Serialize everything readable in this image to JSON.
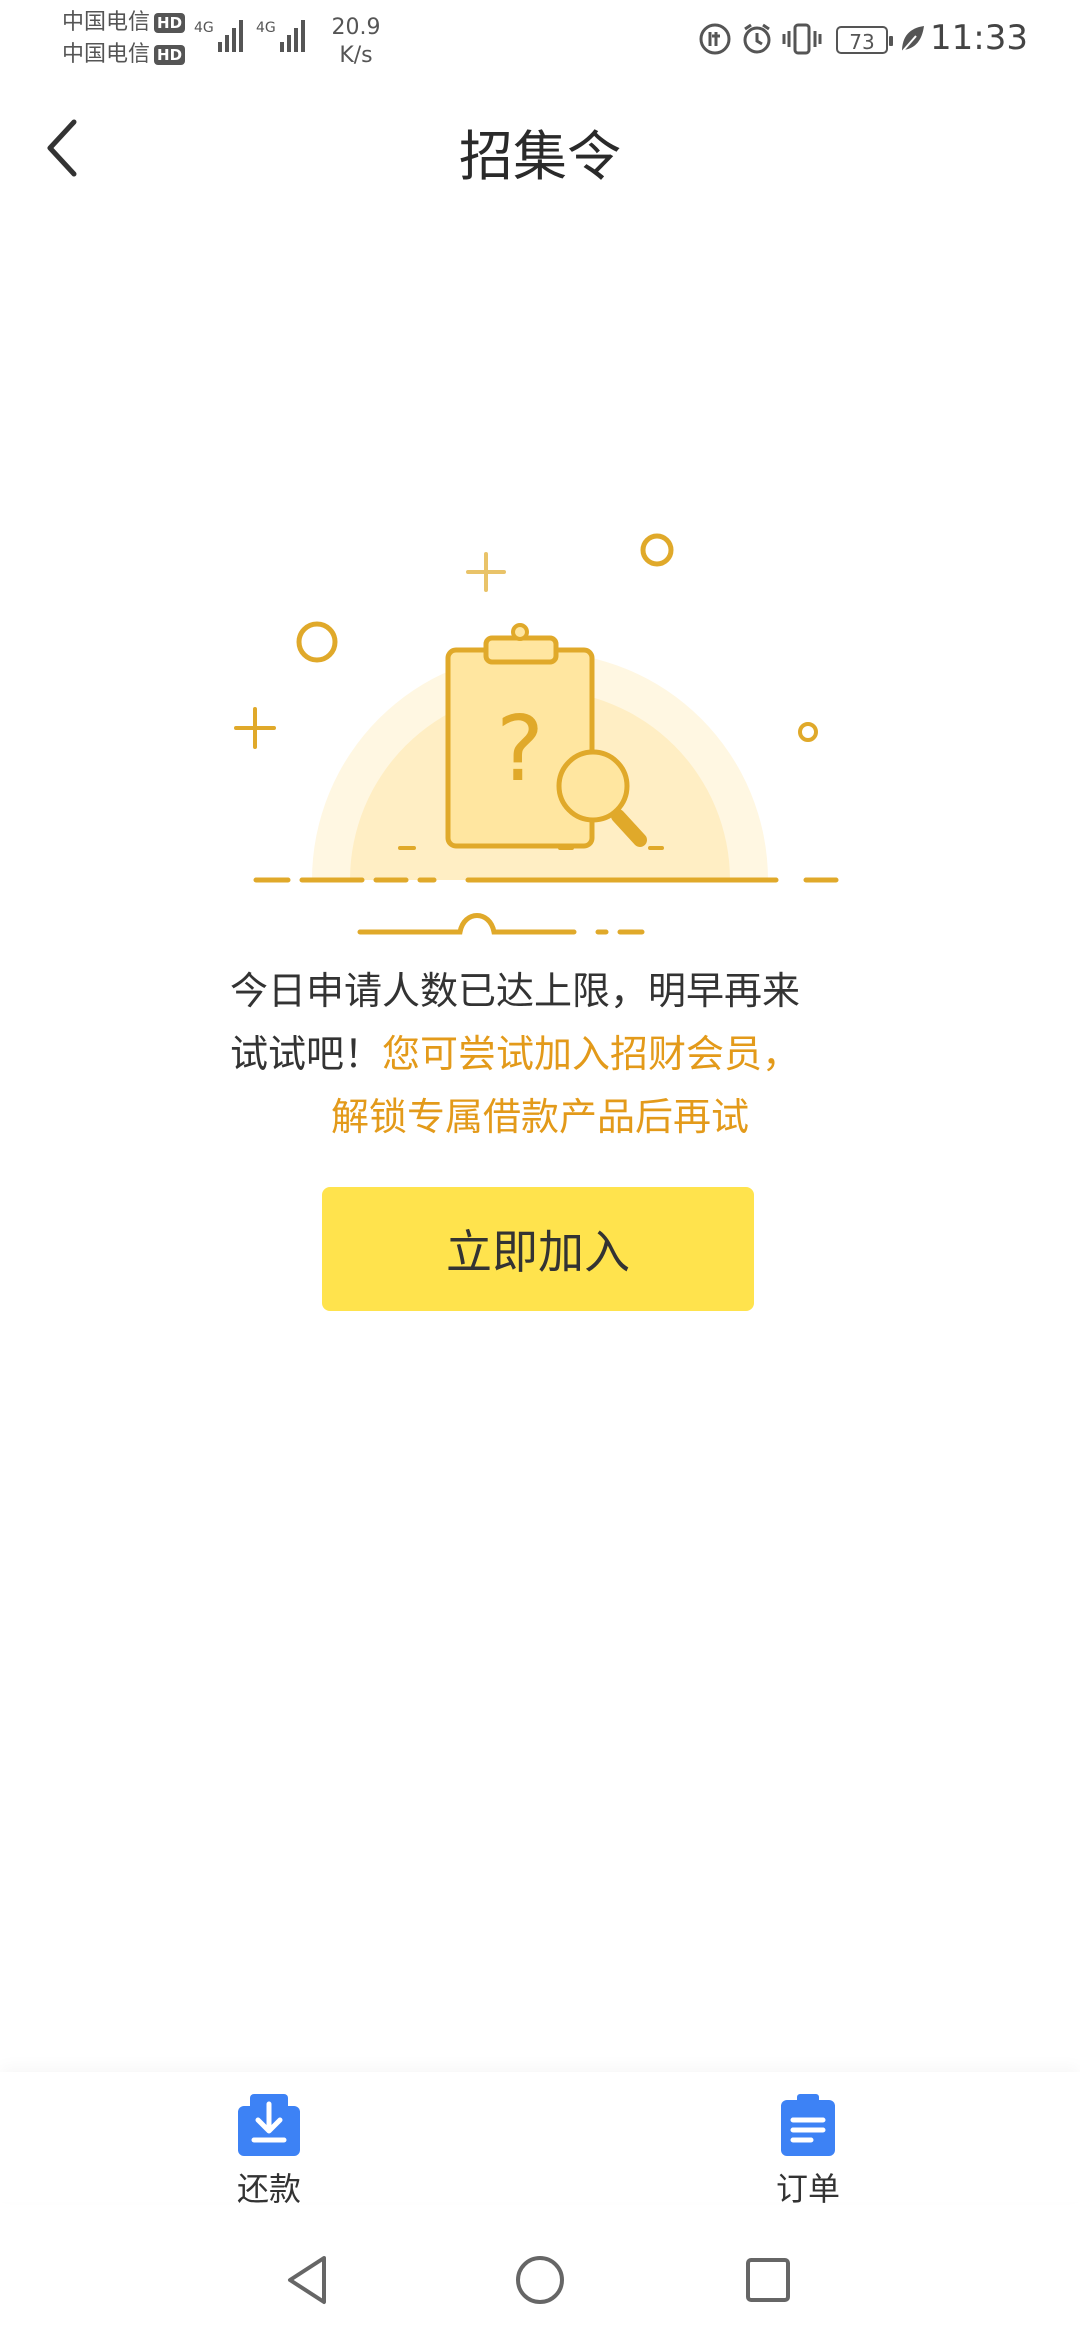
{
  "status_bar": {
    "carrier1": "中国电信",
    "carrier2": "中国电信",
    "hd_badge": "HD",
    "network1": "4G",
    "network2": "4G",
    "speed_value": "20.9",
    "speed_unit": "K/s",
    "battery": "73",
    "time": "11:33"
  },
  "header": {
    "title": "招集令"
  },
  "message": {
    "line1": "今日申请人数已达上限，明早再来",
    "line2_black": "试试吧！",
    "line2_orange": "您可尝试加入招财会员，",
    "line3_orange": "解锁专属借款产品后再试"
  },
  "join_button": {
    "label": "立即加入"
  },
  "bottom_nav": {
    "items": [
      {
        "label": "还款",
        "icon": "download-repay-icon"
      },
      {
        "label": "订单",
        "icon": "clipboard-list-icon"
      }
    ]
  },
  "colors": {
    "accent_orange": "#e39a1a",
    "button_yellow": "#ffe34d",
    "nav_blue": "#3d82f5",
    "illustration_gold": "#e0a92a"
  }
}
